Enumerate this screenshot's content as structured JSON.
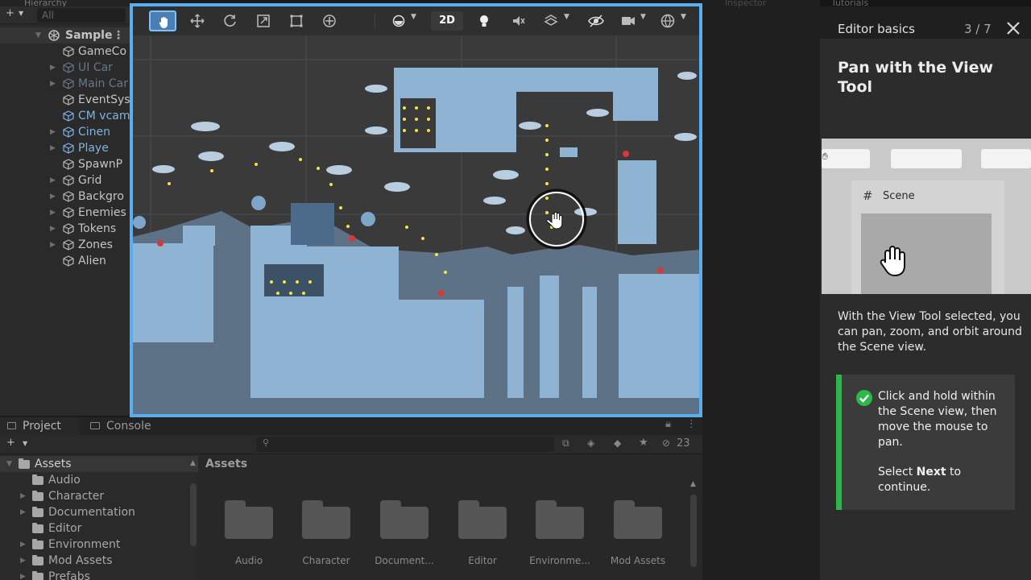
{
  "hierarchy": {
    "tab_label": "Hierarchy",
    "search_placeholder": "All",
    "scene_name": "Sample",
    "items": [
      {
        "label": "GameCo"
      },
      {
        "label": "UI Car"
      },
      {
        "label": "Main Car"
      },
      {
        "label": "EventSys"
      },
      {
        "label": "CM vcam"
      },
      {
        "label": "Cinen"
      },
      {
        "label": "Playe"
      },
      {
        "label": "SpawnP"
      },
      {
        "label": "Grid"
      },
      {
        "label": "Backgro"
      },
      {
        "label": "Enemies"
      },
      {
        "label": "Tokens"
      },
      {
        "label": "Zones"
      },
      {
        "label": "Alien"
      }
    ]
  },
  "scene_toolbar": {
    "tools": [
      "hand-tool",
      "move-tool",
      "rotate-tool",
      "scale-tool",
      "rect-tool",
      "transform-tool"
    ],
    "mode_2d_label": "2D"
  },
  "project": {
    "tabs": [
      {
        "label": "Project"
      },
      {
        "label": "Console"
      }
    ],
    "hidden_count": "23",
    "tree": [
      {
        "label": "Assets"
      },
      {
        "label": "Audio"
      },
      {
        "label": "Character"
      },
      {
        "label": "Documentation"
      },
      {
        "label": "Editor"
      },
      {
        "label": "Environment"
      },
      {
        "label": "Mod Assets"
      },
      {
        "label": "Prefabs"
      }
    ],
    "assets_header": "Assets",
    "folders": [
      {
        "label": "Audio"
      },
      {
        "label": "Character"
      },
      {
        "label": "Document..."
      },
      {
        "label": "Editor"
      },
      {
        "label": "Environme..."
      },
      {
        "label": "Mod Assets"
      }
    ]
  },
  "inspector": {
    "tab_label": "Inspector"
  },
  "tutorial": {
    "tab_label": "Tutorials",
    "title": "Editor basics",
    "step": "3 / 7",
    "heading": "Pan with the View Tool",
    "image_panel_label": "Scene",
    "description": "With the View Tool selected, you can pan, zoom, and orbit around the Scene view.",
    "instruction": "Click and hold within the Scene view, then move the mouse to pan.",
    "next_prefix": "Select ",
    "next_bold": "Next",
    "next_suffix": " to continue."
  },
  "colors": {
    "accent_blue": "#5aaef0",
    "success_green": "#33b14d",
    "scene_tile": "#8fb3d3"
  }
}
